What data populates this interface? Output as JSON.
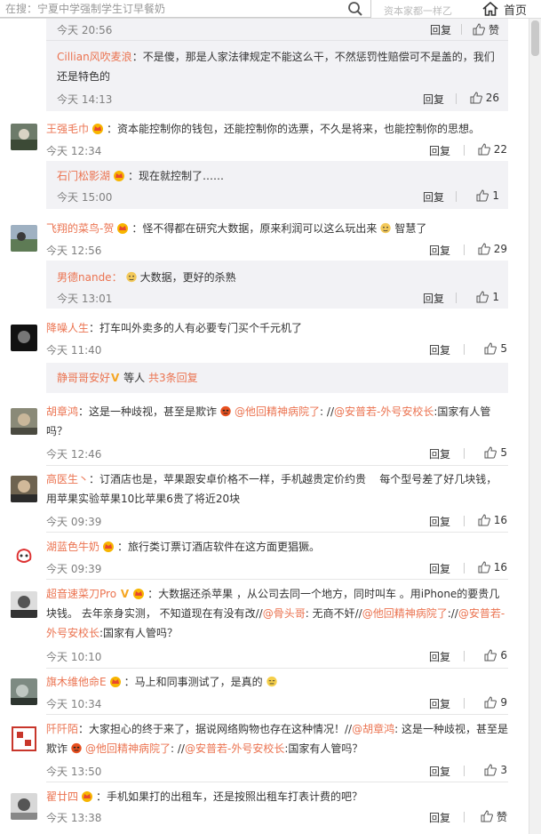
{
  "search": {
    "value": "在搜：宁夏中学强制学生订早餐奶"
  },
  "topbar": {
    "faint_text": "资本家都一样乙",
    "home_label": "首页"
  },
  "comments": [
    {
      "time": "今天 20:56",
      "reply": "回复",
      "like": "赞"
    },
    {
      "name": "Cillian风吹麦浪",
      "text1": "：不是傻，那是人家法律规定不能这么干，不然惩罚性赔偿可不是盖的，我们",
      "text2": "还是特色的",
      "time": "今天 14:13",
      "reply": "回复",
      "like": "26"
    },
    {
      "name": "王强毛巾",
      "text": "：资本能控制你的钱包，还能控制你的选票，不久是将来，也能控制你的思想。",
      "time": "今天 12:34",
      "reply": "回复",
      "like": "22"
    },
    {
      "name": "石门松影湖",
      "text": "：现在就控制了……",
      "time": "今天 15:00",
      "reply": "回复",
      "like": "1"
    },
    {
      "name": "飞翔的菜鸟-贺",
      "text_a": "：怪不得都在研究大数据，原来利润可以这么玩出来",
      "text_b": "智慧了",
      "time": "今天 12:56",
      "reply": "回复",
      "like": "29"
    },
    {
      "name": "男德nande",
      "text": "大数据，更好的杀熟",
      "time": "今天 13:01",
      "reply": "回复",
      "like": "1"
    },
    {
      "name": "降噪人生",
      "text": "：打车叫外卖多的人有必要专门买个千元机了",
      "time": "今天 11:40",
      "reply": "回复",
      "like": "5"
    },
    {
      "name": "静哥哥安好",
      "v": "V",
      "text": "等人",
      "count": "共3条回复"
    },
    {
      "name": "胡章鸿",
      "text_a": "：这是一种歧视，甚至是欺诈",
      "at1": "@他回精神病院了",
      "mid": ": //",
      "at2": "@安普若-外号安校长",
      "text_b": ":国家有人管",
      "text2": "吗？",
      "time": "今天 12:46",
      "reply": "回复",
      "like": "5"
    },
    {
      "name": "高医生丶",
      "text1": "：订酒店也是，苹果跟安卓价格不一样，手机越贵定价约贵    每个型号差了好几块钱，",
      "text2": "用苹果实验苹果10比苹果6贵了将近20块",
      "time": "今天 09:39",
      "reply": "回复",
      "like": "16"
    },
    {
      "name": "湖蓝色牛奶",
      "text": "：旅行类订票订酒店软件在这方面更猖獗。",
      "time": "今天 09:39",
      "reply": "回复",
      "like": "16"
    },
    {
      "name": "超音速菜刀Pro",
      "v": "V",
      "text1": "：大数据还杀苹果 ，从公司去同一个地方，同时叫车 。用iPhone的要贵几",
      "text2_a": "块钱。 去年亲身实测， 不知道现在有没有改//",
      "at1": "@骨头哥",
      "text2_b": ": 无商不奸//",
      "at2": "@他回精神病院了",
      "text2_c": "://",
      "at3": "@安普若-",
      "text3_at": "外号安校长",
      "text3": ":国家有人管吗？",
      "time": "今天 10:10",
      "reply": "回复",
      "like": "6"
    },
    {
      "name": "旗木维他命E",
      "text": "：马上和同事测试了，是真的",
      "time": "今天 10:34",
      "reply": "回复",
      "like": "9"
    },
    {
      "name": "阡阡陌",
      "text1": "：大家担心的终于来了，据说网络购物也存在这种情况！//",
      "at1": "@胡章鸿",
      "text1_b": ": 这是一种歧视，甚至是",
      "text2_a": "欺诈",
      "at2": "@他回精神病院了",
      "mid": ": //",
      "at3": "@安普若-外号安校长",
      "text2_b": ":国家有人管吗？",
      "time": "今天 13:50",
      "reply": "回复",
      "like": "3"
    },
    {
      "name": "翟廿四",
      "text": "：手机如果打的出租车，还是按照出租车打表计费的吧？",
      "time": "今天 13:38",
      "reply": "回复",
      "like": "赞"
    }
  ]
}
